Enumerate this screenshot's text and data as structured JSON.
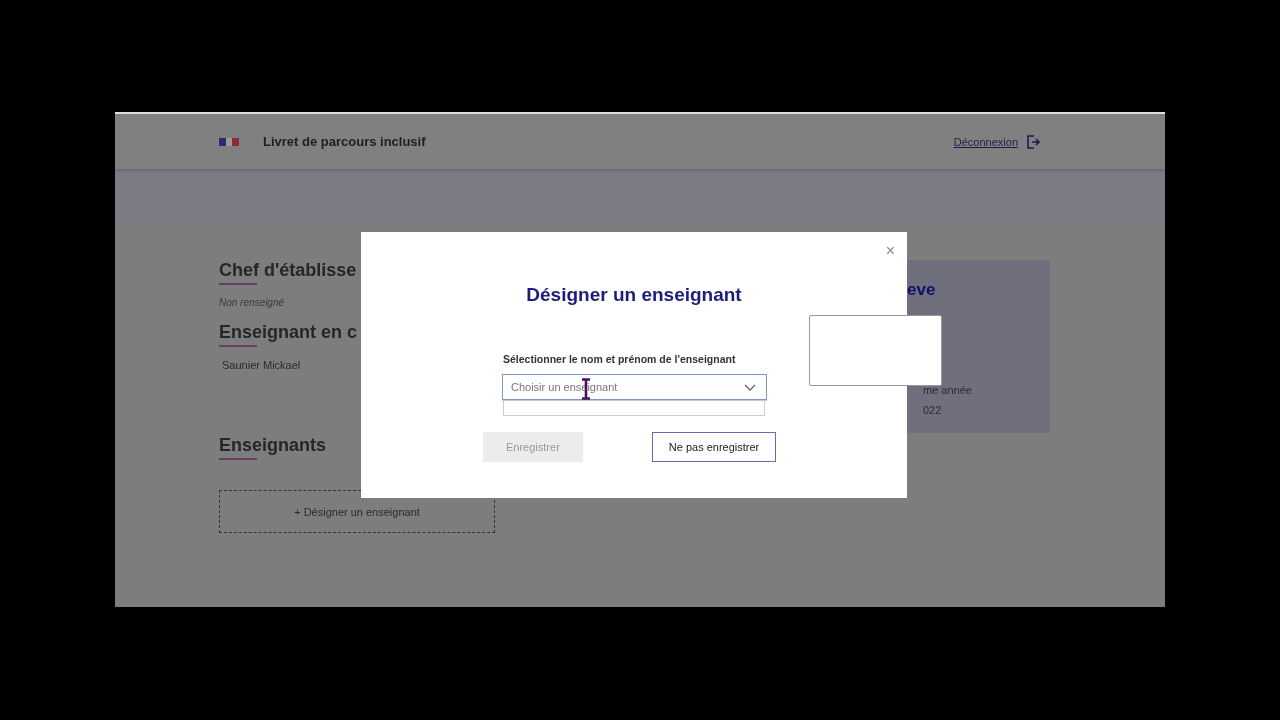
{
  "header": {
    "title": "Livret de parcours inclusif",
    "logout_link": "Déconnexion"
  },
  "sections": [
    {
      "heading": "Chef d'établisse",
      "value": "Non renseigné",
      "kind": "empty"
    },
    {
      "heading": "Enseignant en c",
      "value": "Saunier Mickael",
      "kind": "filled"
    }
  ],
  "teachers": {
    "heading": "Enseignants",
    "add_icon": "+",
    "add_button": "Désigner un enseignant"
  },
  "student_panel": {
    "heading": "eve",
    "lines": [
      "me année",
      "022"
    ]
  },
  "modal": {
    "title": "Désigner un enseignant",
    "close": "×",
    "field": {
      "label": "Sélectionner le nom et prénom de l'enseignant",
      "placeholder": "Choisir un enseignant",
      "expanded": true
    },
    "buttons": [
      {
        "label": "Enregistrer",
        "disabled": true
      },
      {
        "label": "Ne pas enregistrer",
        "disabled": false
      }
    ]
  }
}
